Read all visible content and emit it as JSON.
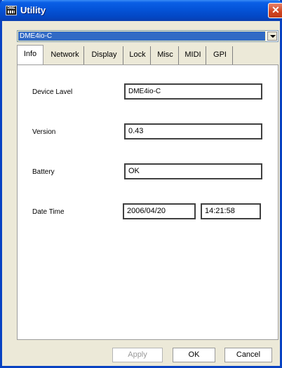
{
  "window": {
    "title": "Utility",
    "icon": "dme-app-icon",
    "icon_text": "DME",
    "close_glyph": "✕"
  },
  "device_select": {
    "value": "DME4io-C"
  },
  "tabs": [
    {
      "label": "Info",
      "active": true
    },
    {
      "label": "Network"
    },
    {
      "label": "Display"
    },
    {
      "label": "Lock"
    },
    {
      "label": "Misc"
    },
    {
      "label": "MIDI"
    },
    {
      "label": "GPI"
    }
  ],
  "info": {
    "device_label": {
      "label": "Device Lavel",
      "value": "DME4io-C"
    },
    "version": {
      "label": "Version",
      "value": "0.43"
    },
    "battery": {
      "label": "Battery",
      "value": "OK"
    },
    "date_time": {
      "label": "Date Time",
      "date": "2006/04/20",
      "time": "14:21:58"
    }
  },
  "buttons": {
    "apply": "Apply",
    "ok": "OK",
    "cancel": "Cancel"
  }
}
